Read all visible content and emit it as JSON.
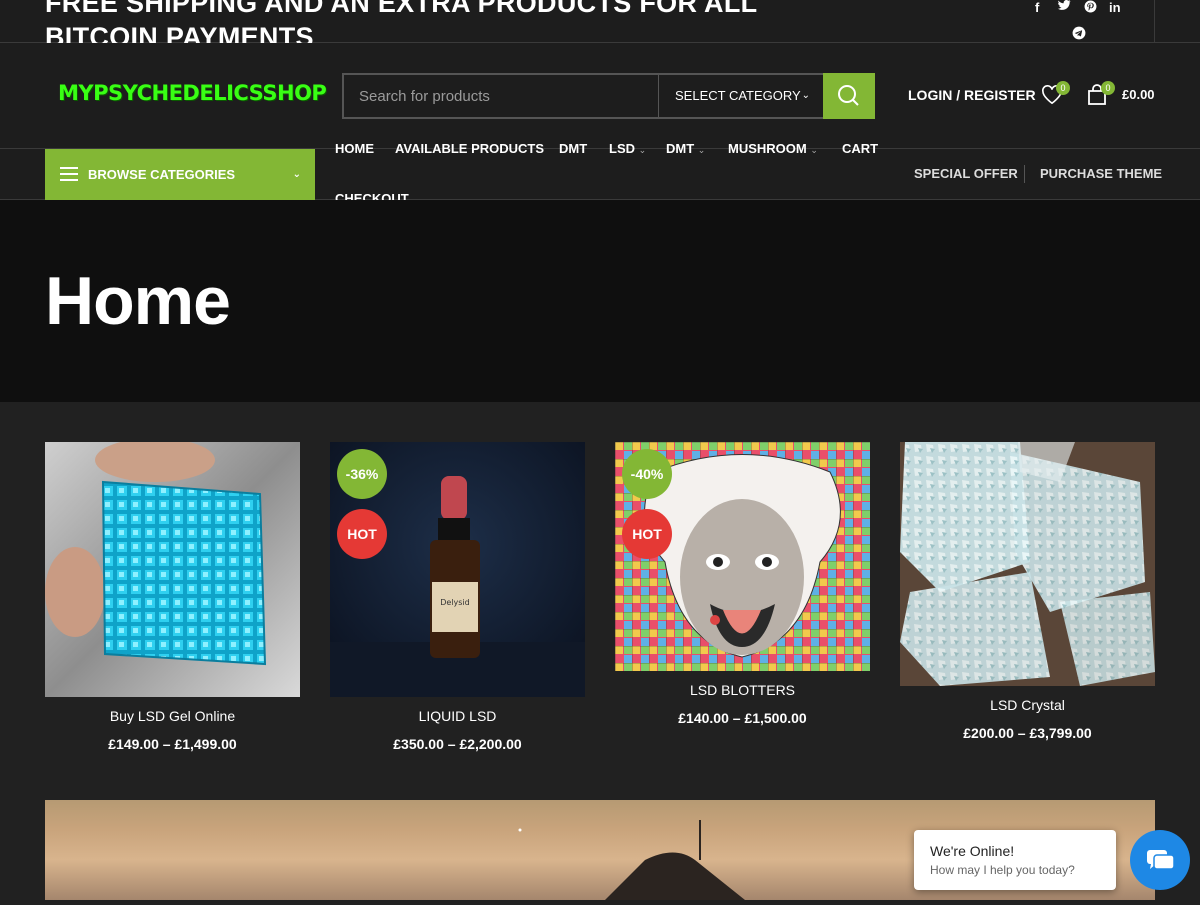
{
  "topbar": {
    "promo": "FREE SHIPPING AND AN EXTRA PRODUCTS FOR ALL BITCOIN PAYMENTS",
    "social": [
      {
        "icon": "facebook-icon",
        "glyph": "f"
      },
      {
        "icon": "twitter-icon",
        "glyph": "t"
      },
      {
        "icon": "pinterest-icon",
        "glyph": "p"
      },
      {
        "icon": "linkedin-icon",
        "glyph": "in"
      },
      {
        "icon": "telegram-icon",
        "glyph": "➤"
      }
    ]
  },
  "header": {
    "logo": "MYPSYCHEDELICSSHOP",
    "search_placeholder": "Search for products",
    "category_select": "SELECT CATEGORY",
    "login": "LOGIN / REGISTER",
    "wishlist_count": "0",
    "cart_count": "0",
    "cart_total": "£0.00"
  },
  "nav": {
    "browse": "BROWSE CATEGORIES",
    "items": [
      "HOME",
      "AVAILABLE PRODUCTS",
      "DMT",
      "LSD",
      "DMT",
      "MUSHROOM",
      "CART",
      "CHECKOUT"
    ],
    "right_links": [
      "SPECIAL OFFER",
      "PURCHASE THEME"
    ]
  },
  "hero": {
    "title": "Home"
  },
  "products": [
    {
      "name": "Buy LSD Gel Online",
      "price_from": "£149.00",
      "price_to": "£1,499.00",
      "badges": []
    },
    {
      "name": "LIQUID LSD",
      "price_from": "£350.00",
      "price_to": "£2,200.00",
      "badges": [
        "-36%",
        "HOT"
      ]
    },
    {
      "name": "LSD BLOTTERS",
      "price_from": "£140.00",
      "price_to": "£1,500.00",
      "badges": [
        "-40%",
        "HOT"
      ]
    },
    {
      "name": "LSD Crystal",
      "price_from": "£200.00",
      "price_to": "£3,799.00",
      "badges": []
    }
  ],
  "bottle_label": "Delysid",
  "chat": {
    "title": "We're Online!",
    "subtitle": "How may I help you today?"
  },
  "colors": {
    "accent": "#83b735",
    "hot": "#e53935",
    "chat": "#1e88e5"
  }
}
